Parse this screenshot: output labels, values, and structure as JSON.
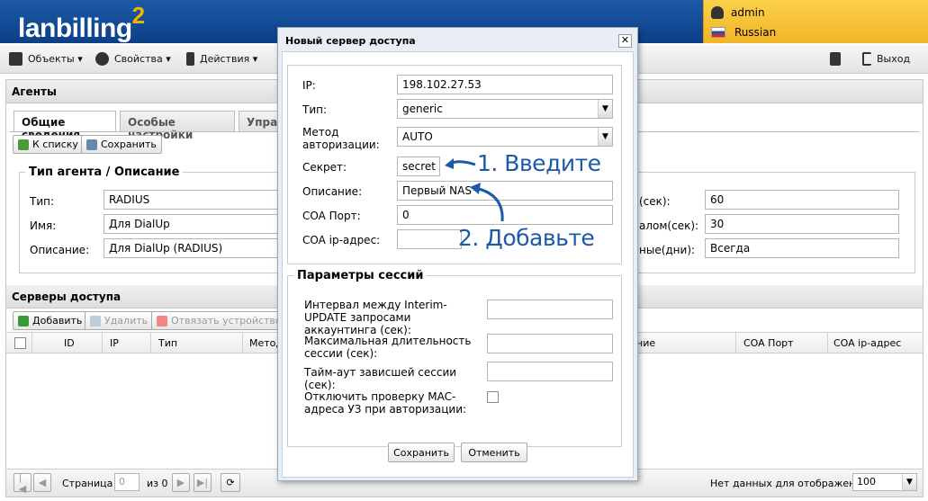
{
  "header": {
    "logo": "lanbilling",
    "logo_sup": "2",
    "user": "admin",
    "language": "Russian"
  },
  "toolbar": {
    "objects": "Объекты",
    "properties": "Свойства",
    "actions": "Действия",
    "logout": "Выход"
  },
  "panel": {
    "title": "Агенты",
    "tabs": [
      "Общие сведения",
      "Особые настройки",
      "Управл"
    ],
    "buttons": {
      "to_list": "К списку",
      "save": "Сохранить"
    },
    "agent_section": {
      "legend": "Тип агента / Описание",
      "type_label": "Тип:",
      "type_value": "RADIUS",
      "name_label": "Имя:",
      "name_value": "Для DialUp",
      "desc_label": "Описание:",
      "desc_value": "Для DialUp (RADIUS)"
    },
    "right_fields": [
      {
        "label": "(сек):",
        "value": "60"
      },
      {
        "label": "алом(сек):",
        "value": "30"
      },
      {
        "label": "ные(дни):",
        "value": "Всегда"
      }
    ],
    "servers": {
      "title": "Серверы доступа",
      "add": "Добавить",
      "delete": "Удалить",
      "unbind": "Отвязать устройство",
      "columns_left": [
        "ID",
        "IP",
        "Тип",
        "Метод"
      ],
      "columns_right": [
        "ние",
        "COA Порт",
        "COA ip-адрес"
      ]
    },
    "pager": {
      "page_label": "Страница",
      "page_value": "0",
      "of_label": "из 0",
      "no_data": "Нет данных для отображения",
      "page_size": "100"
    }
  },
  "modal": {
    "title": "Новый сервер доступа",
    "ip_label": "IP:",
    "ip_value": "198.102.27.53",
    "type_label": "Тип:",
    "type_value": "generic",
    "auth_label": "Метод авторизации:",
    "auth_value": "AUTO",
    "secret_label": "Секрет:",
    "secret_value": "secret",
    "desc_label": "Описание:",
    "desc_value": "Первый NAS",
    "coa_port_label": "COA Порт:",
    "coa_port_value": "0",
    "coa_ip_label": "COA ip-адрес:",
    "coa_ip_value": "",
    "session_legend": "Параметры сессий",
    "interim_label": "Интервал между Interim-UPDATE запросами аккаунтинга (сек):",
    "maxdur_label": "Максимальная длительность сессии (сек):",
    "timeout_label": "Тайм-аут зависшей сессии (сек):",
    "mac_label": "Отключить проверку MAC-адреса УЗ при авторизации:",
    "save": "Сохранить",
    "cancel": "Отменить"
  },
  "annotations": {
    "step1": "1. Введите",
    "step2": "2. Добавьте"
  },
  "colors": {
    "header_blue": "#0d3f86",
    "accent_yellow": "#f2b526",
    "annot_blue": "#1c5aa6"
  }
}
